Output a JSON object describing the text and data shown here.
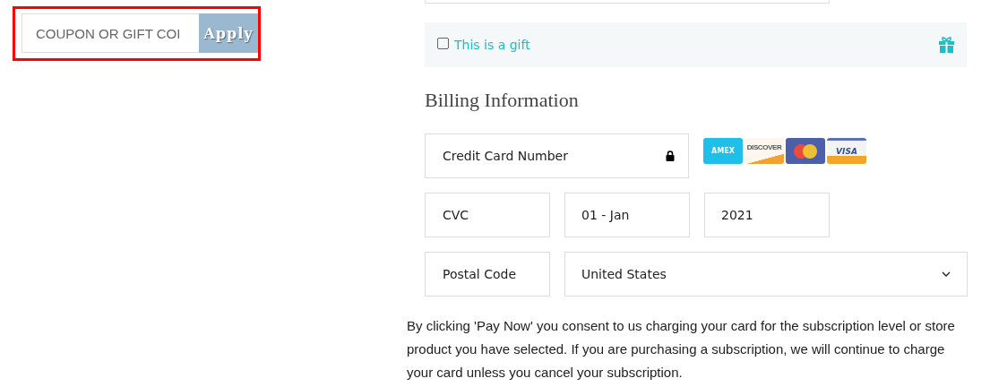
{
  "coupon": {
    "placeholder": "COUPON OR GIFT COI",
    "button": "Apply",
    "highlighted": true
  },
  "gift": {
    "label": "This is a gift",
    "checked": false
  },
  "billing": {
    "title": "Billing Information",
    "card_number": {
      "placeholder": "Credit Card Number"
    },
    "card_brands": [
      {
        "label": "AMEX",
        "kind": "amex"
      },
      {
        "label": "DISCOVER",
        "kind": "discover"
      },
      {
        "kind": "mastercard"
      },
      {
        "label": "VISA",
        "kind": "visa"
      }
    ],
    "cvc": {
      "placeholder": "CVC"
    },
    "expiry_month": {
      "value": "01 - Jan"
    },
    "expiry_year": {
      "value": "2021"
    },
    "postal_code": {
      "placeholder": "Postal Code"
    },
    "country": {
      "value": "United States"
    }
  },
  "consent_text": "By clicking 'Pay Now' you consent to us charging your card for the subscription level or store product you have selected. If you are purchasing a subscription, we will continue to charge your card unless you cancel your subscription."
}
